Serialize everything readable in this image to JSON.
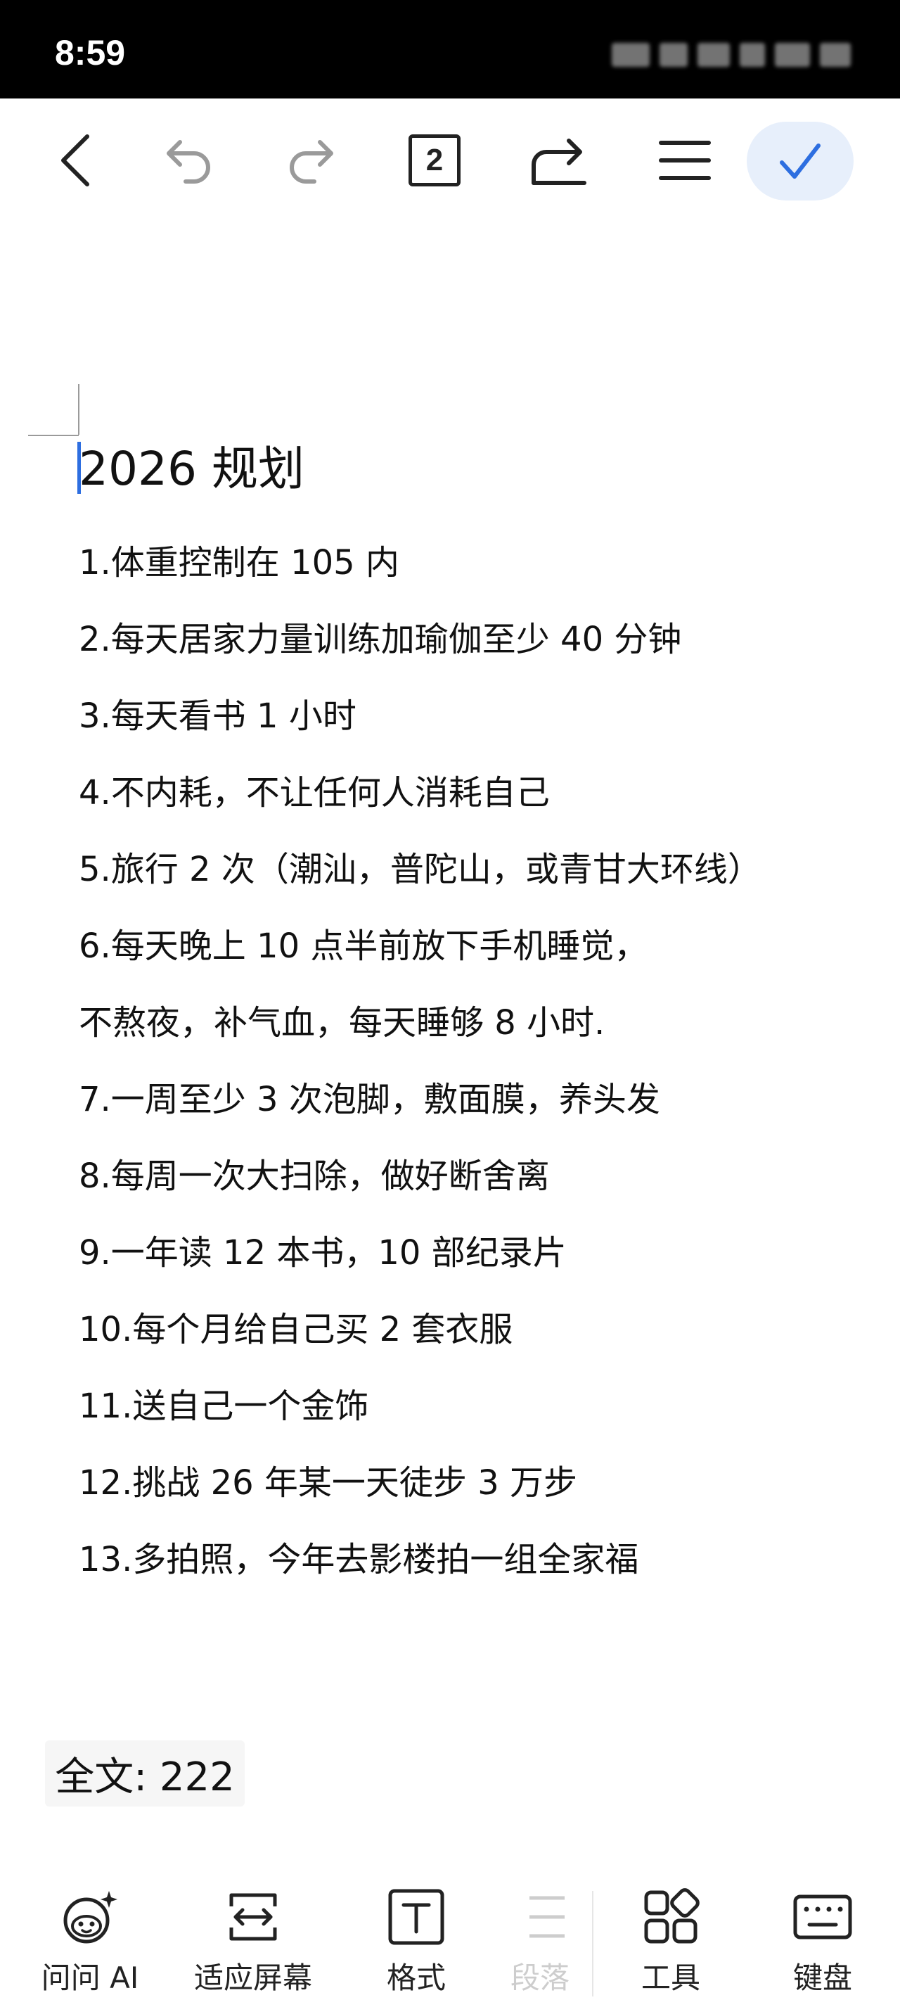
{
  "status_bar": {
    "time": "8:59"
  },
  "toolbar": {
    "back_icon": "chevron-left-icon",
    "undo_icon": "undo-icon",
    "redo_icon": "redo-icon",
    "page_count": "2",
    "share_icon": "share-icon",
    "menu_icon": "menu-icon",
    "done_icon": "check-icon",
    "done_color": "#2d6ee0",
    "done_bg": "#e7effb"
  },
  "document": {
    "title": "2026 规划",
    "lines": [
      "1.体重控制在 105 内",
      "2.每天居家力量训练加瑜伽至少 40 分钟",
      "3.每天看书 1 小时",
      "4.不内耗，不让任何人消耗自己",
      "5.旅行 2 次（潮汕，普陀山，或青甘大环线）",
      "6.每天晚上 10 点半前放下手机睡觉，",
      "不熬夜，补气血，每天睡够 8 小时.",
      "7.一周至少 3 次泡脚，敷面膜，养头发",
      "8.每周一次大扫除，做好断舍离",
      "9.一年读 12 本书，10 部纪录片",
      "10.每个月给自己买 2 套衣服",
      "11.送自己一个金饰",
      "12.挑战 26 年某一天徒步 3 万步",
      "13.多拍照，今年去影楼拍一组全家福"
    ]
  },
  "word_count": {
    "label": "全文: 222"
  },
  "bottom_bar": {
    "items": [
      {
        "label": "问问 AI",
        "icon": "ai-assistant-icon"
      },
      {
        "label": "适应屏幕",
        "icon": "fit-screen-icon"
      },
      {
        "label": "格式",
        "icon": "text-format-icon"
      },
      {
        "label": "段落",
        "icon": "paragraph-icon"
      },
      {
        "label": "工具",
        "icon": "tools-grid-icon"
      },
      {
        "label": "键盘",
        "icon": "keyboard-icon"
      }
    ]
  }
}
